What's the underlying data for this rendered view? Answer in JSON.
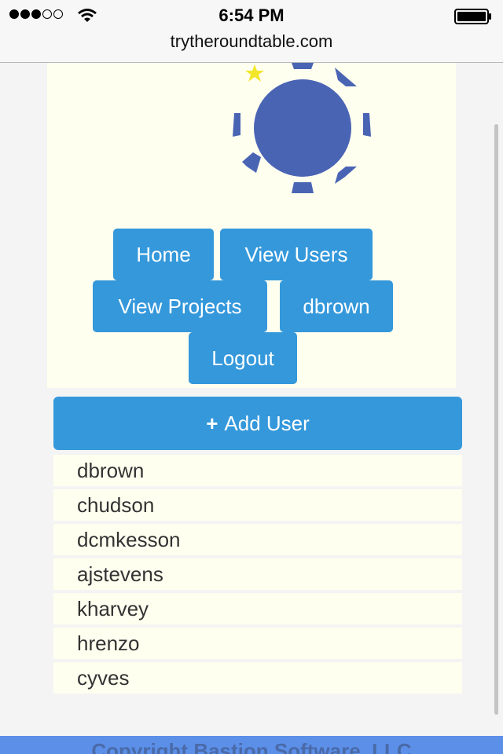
{
  "status_bar": {
    "signal_bars_filled": 3,
    "signal_bars_total": 5,
    "time": "6:54 PM"
  },
  "browser": {
    "url": "trytheroundtable.com"
  },
  "logo": {
    "icon": "sun-star-logo",
    "colors": {
      "sun": "#4a64b4",
      "star": "#f2e62a"
    }
  },
  "nav": {
    "home": "Home",
    "view_users": "View Users",
    "view_projects": "View Projects",
    "current_user": "dbrown",
    "logout": "Logout"
  },
  "add_user": {
    "icon": "+",
    "label": "Add User"
  },
  "users": [
    "dbrown",
    "chudson",
    "dcmkesson",
    "ajstevens",
    "kharvey",
    "hrenzo",
    "cyves"
  ],
  "footer": {
    "text": "Copyright Bastion Software, LLC"
  },
  "colors": {
    "accent": "#3498db",
    "panel": "#fffff0",
    "footer": "#5b8fe8"
  }
}
